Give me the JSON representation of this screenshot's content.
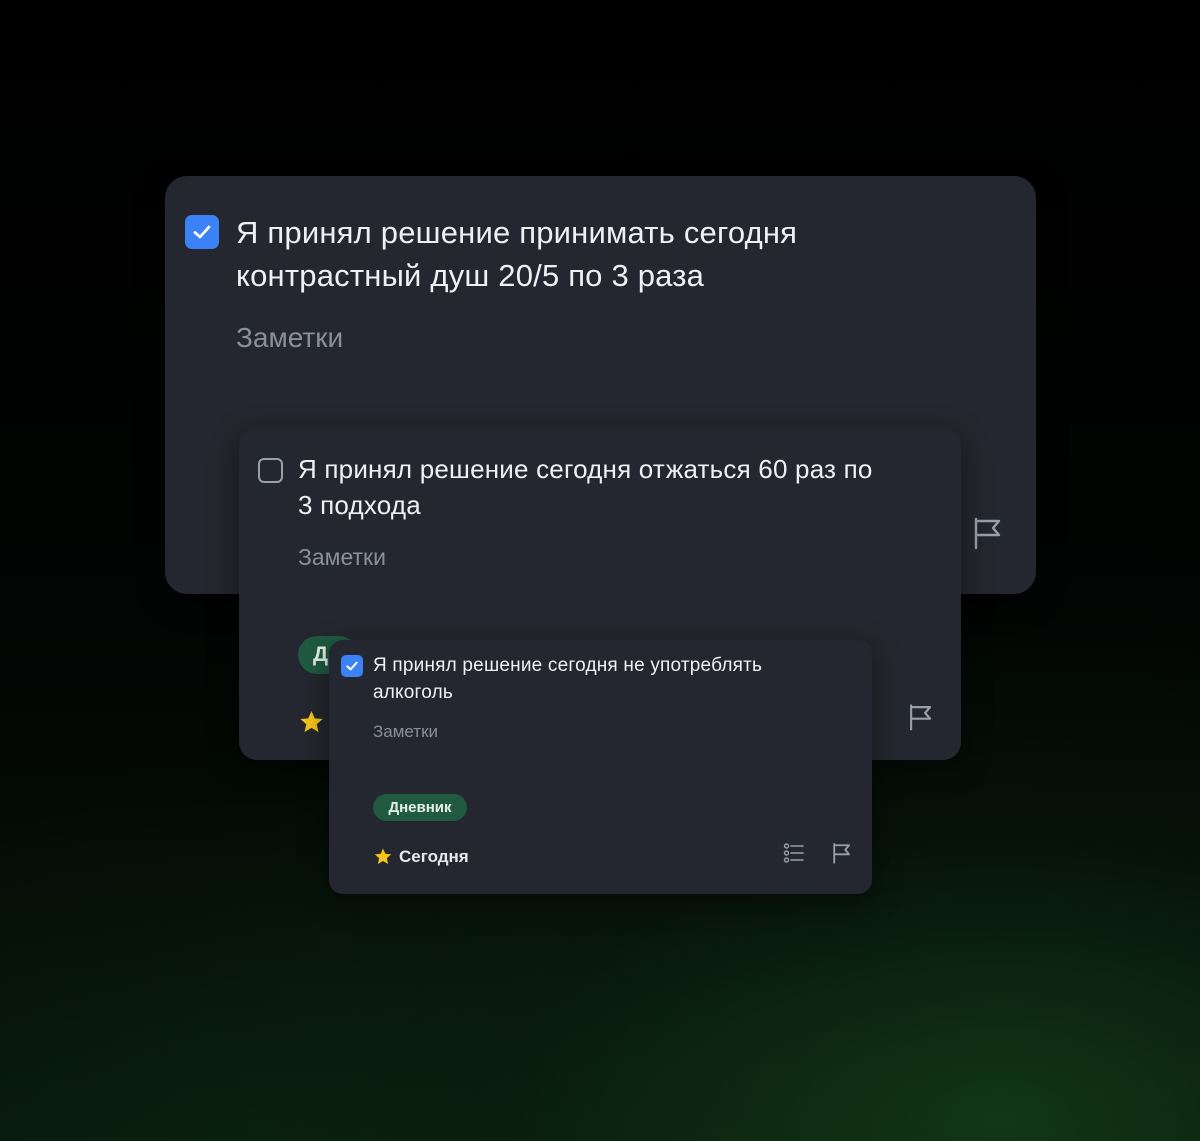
{
  "cards": [
    {
      "completed": true,
      "title_line1": "Я принял решение принимать сегодня",
      "title_line2": "контрастный душ 20/5 по 3 раза",
      "notes_placeholder": "Заметки"
    },
    {
      "completed": false,
      "title_line1": "Я принял решение сегодня отжаться 60 раз по",
      "title_line2": "3 подхода",
      "notes_placeholder": "Заметки",
      "tag_partial": "Д"
    },
    {
      "completed": true,
      "title_line1": "Я принял решение сегодня не употреблять",
      "title_line2": "алкоголь",
      "notes_placeholder": "Заметки",
      "tag_label": "Дневник",
      "when_label": "Сегодня"
    }
  ],
  "colors": {
    "background": "#000000",
    "card": "#24272f",
    "checkbox_accent": "#3b82f6",
    "tag_green": "#1f5a41",
    "star_yellow": "#f5c518",
    "text_primary": "#eef0f3",
    "text_secondary": "#8a8f99"
  },
  "icons": {
    "check": "check-icon",
    "flag": "flag-icon",
    "checklist": "checklist-icon",
    "star": "star-icon"
  }
}
